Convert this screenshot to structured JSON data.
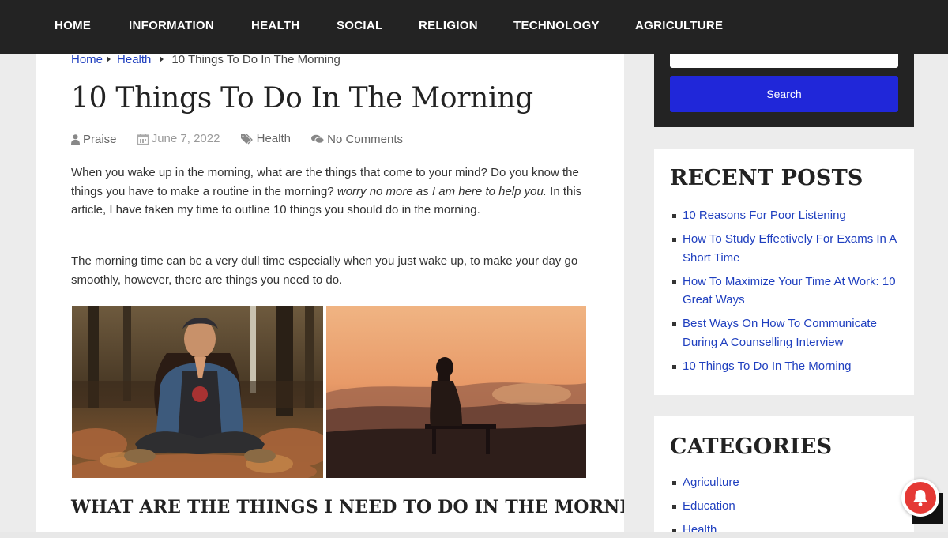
{
  "nav": {
    "items": [
      "HOME",
      "INFORMATION",
      "HEALTH",
      "SOCIAL",
      "RELIGION",
      "TECHNOLOGY",
      "AGRICULTURE"
    ]
  },
  "breadcrumb": {
    "home": "Home",
    "category": "Health",
    "current": "10 Things To Do In The Morning"
  },
  "post": {
    "title": "10 Things To Do In The Morning",
    "author": "Praise",
    "date": "June 7, 2022",
    "category": "Health",
    "comments": "No Comments",
    "p1_before": "When you wake up in the morning, what are the things that come to your mind? Do you know the things you have to make a routine in the morning? ",
    "p1_em": "worry no more as I am here to help you.",
    "p1_after": " In this article, I have taken my time to outline 10 things you should do in the morning.",
    "p2": "The morning time can be a very dull time especially when you just wake up, to make your day go smoothly, however, there are things you need to do.",
    "heading": "WHAT ARE THE THINGS I NEED TO DO IN THE MORNING?"
  },
  "sidebar": {
    "search_button": "Search",
    "recent_title": "RECENT POSTS",
    "recent_posts": [
      "10 Reasons For Poor Listening",
      "How To Study Effectively For Exams In A Short Time",
      "How To Maximize Your Time At Work: 10 Great Ways",
      "Best Ways On How To Communicate During A Counselling Interview",
      "10 Things To Do In The Morning"
    ],
    "categories_title": "CATEGORIES",
    "categories": [
      "Agriculture",
      "Education",
      "Health"
    ]
  },
  "colors": {
    "nav_bg": "#232323",
    "link": "#1f3fbf",
    "search_button": "#2027d9",
    "bell": "#e53935"
  },
  "icons": [
    "user-icon",
    "calendar-icon",
    "tag-icon",
    "comments-icon",
    "bell-icon",
    "scroll-top-icon"
  ]
}
